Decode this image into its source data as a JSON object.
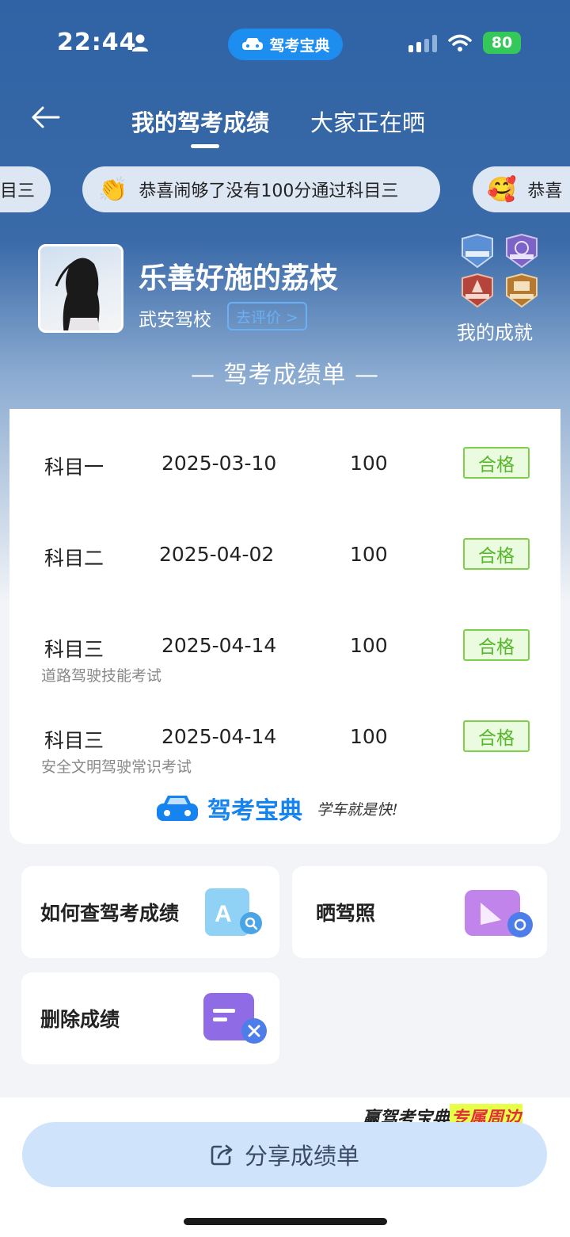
{
  "status_bar": {
    "time": "22:44",
    "app_name": "驾考宝典",
    "battery": "80",
    "icons": [
      "person-icon",
      "signal-icon",
      "wifi-icon",
      "battery-icon"
    ]
  },
  "nav": {
    "tabs": [
      {
        "label": "我的驾考成绩",
        "active": true
      },
      {
        "label": "大家正在晒",
        "active": false
      }
    ]
  },
  "ticker": {
    "items": [
      {
        "text": "目三",
        "emoji": ""
      },
      {
        "text": "恭喜闹够了没有100分通过科目三",
        "emoji": "👏"
      },
      {
        "text": "恭喜",
        "emoji": "🥰"
      }
    ]
  },
  "profile": {
    "username": "乐善好施的荔枝",
    "school": "武安驾校",
    "rate_button": "去评价 >",
    "achievements_label": "我的成就"
  },
  "score_sheet": {
    "title": "— 驾考成绩单 —",
    "rows": [
      {
        "subject": "科目一",
        "date": "2025-03-10",
        "score": "100",
        "status": "合格",
        "note": ""
      },
      {
        "subject": "科目二",
        "date": "2025-04-02",
        "score": "100",
        "status": "合格",
        "note": ""
      },
      {
        "subject": "科目三",
        "date": "2025-04-14",
        "score": "100",
        "status": "合格",
        "note": "道路驾驶技能考试"
      },
      {
        "subject": "科目三",
        "date": "2025-04-14",
        "score": "100",
        "status": "合格",
        "note": "安全文明驾驶常识考试"
      }
    ],
    "brand_name": "驾考宝典",
    "brand_slogan": "学车就是快!"
  },
  "actions": [
    {
      "label": "如何查驾考成绩",
      "icon": "search-document-icon"
    },
    {
      "label": "晒驾照",
      "icon": "photo-camera-icon"
    },
    {
      "label": "删除成绩",
      "icon": "delete-record-icon"
    }
  ],
  "promo": {
    "prefix": "赢驾考宝典",
    "highlight": "专属周边"
  },
  "share_button": "分享成绩单",
  "colors": {
    "primary_blue": "#1684f0",
    "header_blue": "#2f63a5",
    "pass_green": "#57b62a",
    "share_bg": "#cfe3fb"
  }
}
